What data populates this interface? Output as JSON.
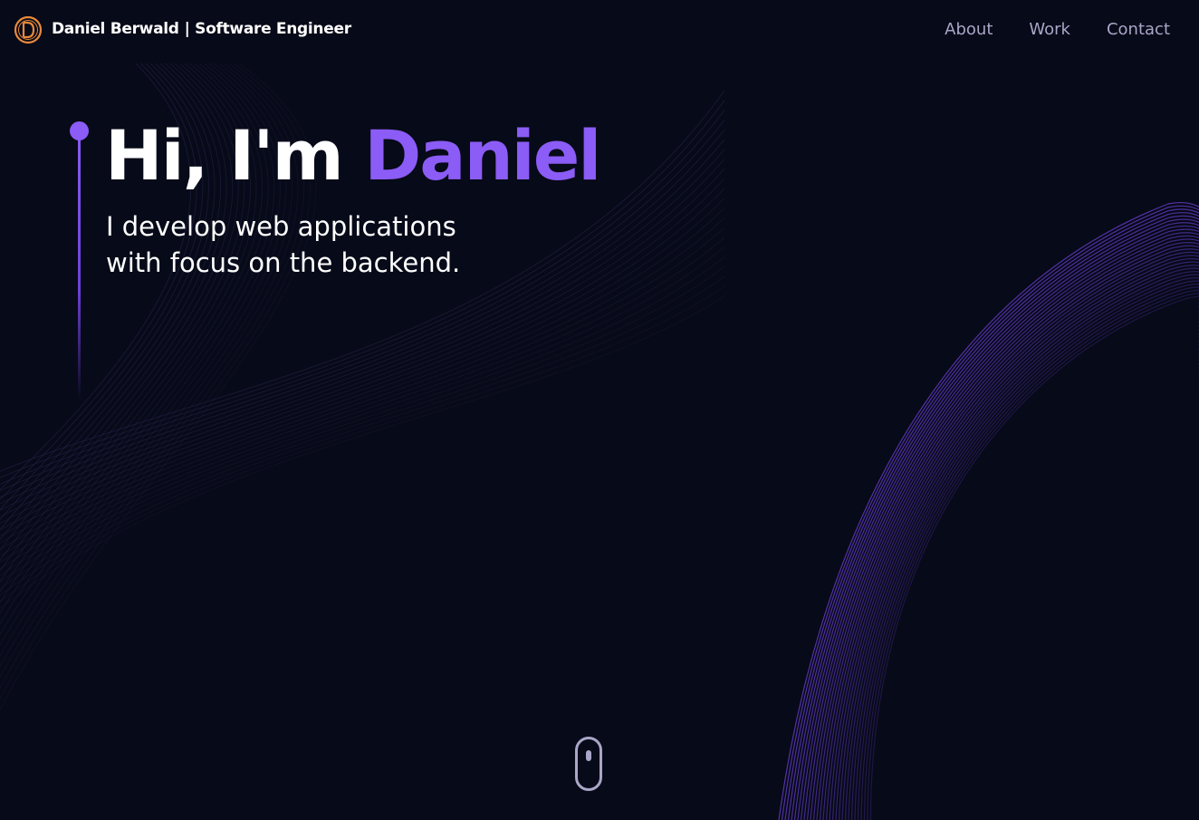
{
  "nav": {
    "brand_name": "Daniel Berwald",
    "brand_tagline": "| Software Engineer",
    "logo_letter": "D",
    "links": [
      {
        "label": "About"
      },
      {
        "label": "Work"
      },
      {
        "label": "Contact"
      }
    ]
  },
  "hero": {
    "title_prefix": "Hi, I'm",
    "title_name": "Daniel",
    "subtitle_line1": "I develop web applications",
    "subtitle_line2": "with focus on the backend."
  },
  "colors": {
    "background": "#070a18",
    "accent": "#8b5cf6",
    "nav_link": "#a9a6c8",
    "logo": "#e8893a"
  },
  "icons": {
    "logo": "circled-letter-logo-icon",
    "scroll": "mouse-scroll-icon"
  }
}
